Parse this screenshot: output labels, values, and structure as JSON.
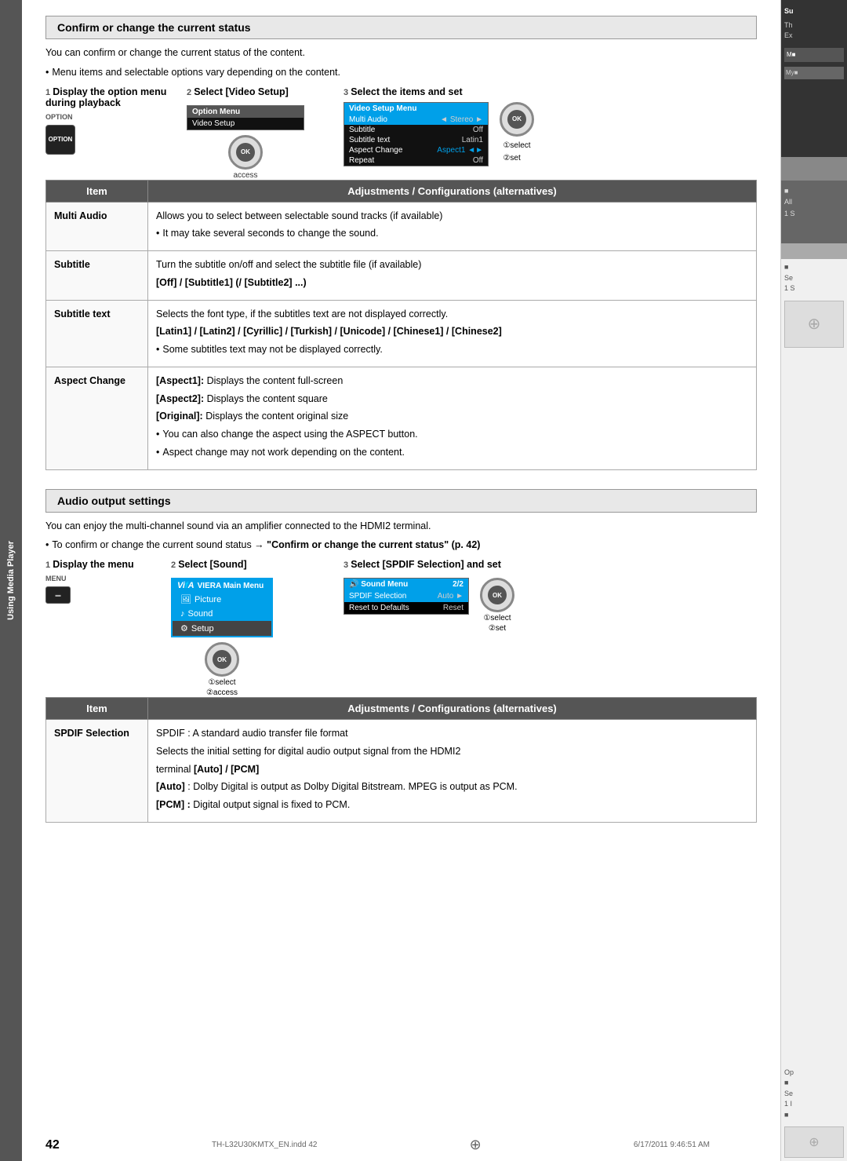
{
  "page": {
    "number": "42",
    "footer_left": "TH-L32U30KMTX_EN.indd  42",
    "footer_right": "6/17/2011  9:46:51 AM"
  },
  "sidebar_tab": {
    "label": "Using Media Player"
  },
  "section1": {
    "header": "Confirm or change the current status",
    "intro1": "You can confirm or change the current status of the content.",
    "intro2": "Menu items and selectable options vary depending on the content.",
    "step1_num": "1",
    "step1_title": "Display the option menu during playback",
    "step1_label": "OPTION",
    "step2_num": "2",
    "step2_title": "Select [Video Setup]",
    "step3_num": "3",
    "step3_title": "Select the items and set",
    "option_menu_label": "Option Menu",
    "option_menu_item": "Video Setup",
    "video_setup_menu_label": "Video Setup Menu",
    "video_menu_items": [
      {
        "name": "Multi Audio",
        "value": "Stereo"
      },
      {
        "name": "Subtitle",
        "value": "Off"
      },
      {
        "name": "Subtitle text",
        "value": "Latin1"
      },
      {
        "name": "Aspect Change",
        "value": "Aspect1"
      },
      {
        "name": "Repeat",
        "value": "Off"
      }
    ],
    "select_label": "①select",
    "set_label": "②set",
    "access_label": "access",
    "table_headers": [
      "Item",
      "Adjustments / Configurations (alternatives)"
    ],
    "table_rows": [
      {
        "item": "Multi Audio",
        "desc": "Allows you to select between selectable sound tracks (if available)",
        "bullet": "It may take several seconds to change the sound."
      },
      {
        "item": "Subtitle",
        "desc": "Turn the subtitle on/off and select the subtitle file (if available)",
        "bold_line": "[Off] / [Subtitle1] (/ [Subtitle2] ...)"
      },
      {
        "item": "Subtitle text",
        "desc": "Selects the font type, if the subtitles text are not displayed correctly.",
        "bold_line": "[Latin1] / [Latin2] / [Cyrillic] / [Turkish] / [Unicode] / [Chinese1] / [Chinese2]",
        "bullet": "Some subtitles text may not be displayed correctly."
      },
      {
        "item": "Aspect Change",
        "lines": [
          "[Aspect1]: Displays the content full-screen",
          "[Aspect2]: Displays the content square",
          "[Original]: Displays the content original size"
        ],
        "bullets": [
          "You can also change the aspect using the ASPECT button.",
          "Aspect change may not work depending on the content."
        ]
      }
    ]
  },
  "section2": {
    "header": "Audio output settings",
    "intro1": "You can enjoy the multi-channel sound via an amplifier connected to the HDMI2 terminal.",
    "intro2": "To confirm or change the current sound status → \"Confirm or change the current status\" (p. 42)",
    "step1_num": "1",
    "step1_title": "Display the menu",
    "step1_label": "MENU",
    "step2_num": "2",
    "step2_title": "Select [Sound]",
    "step3_num": "3",
    "step3_title": "Select [SPDIF Selection] and set",
    "viera_label": "VIERA Main Menu",
    "menu_items": [
      {
        "label": "Picture",
        "icon": "picture"
      },
      {
        "label": "Sound",
        "icon": "sound"
      },
      {
        "label": "Setup",
        "icon": "setup"
      }
    ],
    "select_label": "①select",
    "access_label": "②access",
    "sound_menu_label": "Sound Menu",
    "sound_menu_page": "2/2",
    "sound_menu_items": [
      {
        "name": "SPDIF Selection",
        "value": "Auto"
      },
      {
        "name": "Reset to Defaults",
        "value": "Reset"
      }
    ],
    "select_label2": "①select",
    "set_label2": "②set",
    "table_headers": [
      "Item",
      "Adjustments / Configurations (alternatives)"
    ],
    "table_rows": [
      {
        "item": "SPDIF Selection",
        "lines": [
          "SPDIF : A standard audio transfer file format",
          "Selects the initial setting for digital audio output signal from the HDMI2 terminal [Auto] / [PCM]",
          "[Auto] : Dolby Digital is output as Dolby Digital Bitstream. MPEG is output as PCM.",
          "[PCM] : Digital output signal is fixed to PCM."
        ],
        "bold_parts": [
          "terminal [Auto] / [PCM]"
        ]
      }
    ]
  }
}
